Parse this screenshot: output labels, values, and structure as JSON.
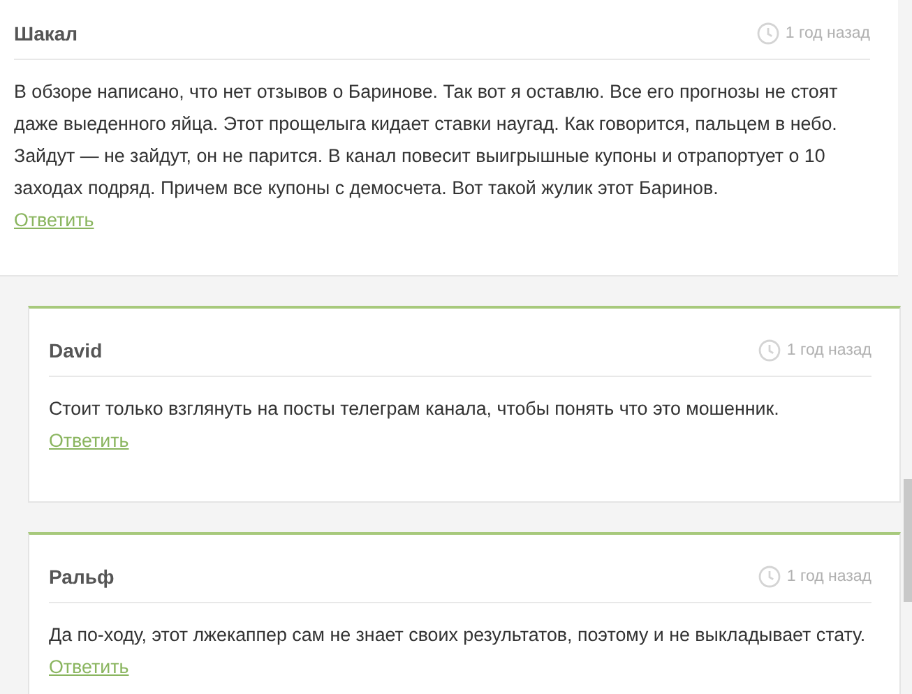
{
  "comments": [
    {
      "author": "Шакал",
      "time": "1 год назад",
      "text": "В обзоре написано, что нет отзывов о Баринове. Так вот я оставлю. Все его прогнозы не стоят даже выеденного яйца. Этот прощелыга кидает ставки наугад. Как говорится, пальцем в небо. Зайдут — не зайдут, он не парится. В канал повесит выигрышные купоны и отрапортует о 10 заходах подряд. Причем все купоны с демосчета. Вот такой жулик этот Баринов.",
      "reply_label": "Ответить",
      "children": [
        {
          "author": "David",
          "time": "1 год назад",
          "text": "Стоит только взглянуть на посты телеграм канала, чтобы понять что это мошенник.",
          "reply_label": "Ответить"
        },
        {
          "author": "Ральф",
          "time": "1 год назад",
          "text": "Да по-ходу, этот лжекаппер сам не знает своих результатов, поэтому и не выкладывает стату.",
          "reply_label": "Ответить"
        }
      ]
    }
  ]
}
